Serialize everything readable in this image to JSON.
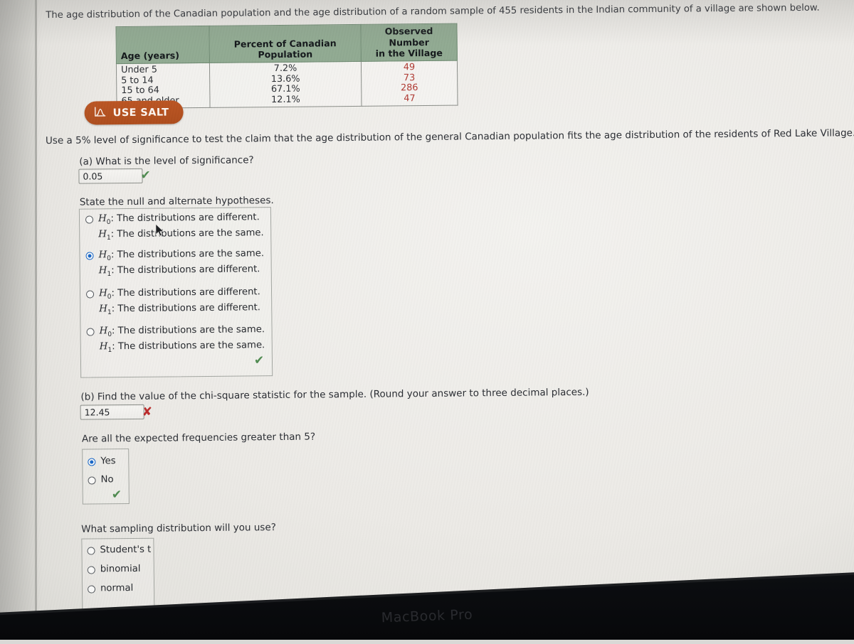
{
  "intro": {
    "paragraph": "The age distribution of the Canadian population and the age distribution of a random sample of 455 residents in the Indian community of a village are shown below."
  },
  "table": {
    "headers": {
      "age": "Age (years)",
      "percent": "Percent of Canadian Population",
      "observed_line1": "Observed Number",
      "observed_line2": "in the Village"
    },
    "rows": [
      {
        "age": "Under 5",
        "percent": "7.2%",
        "observed": "49"
      },
      {
        "age": "5 to 14",
        "percent": "13.6%",
        "observed": "73"
      },
      {
        "age": "15 to 64",
        "percent": "67.1%",
        "observed": "286"
      },
      {
        "age": "65 and older",
        "percent": "12.1%",
        "observed": "47"
      }
    ]
  },
  "salt_button": {
    "label": "USE SALT",
    "icon": "distribution-curve-icon"
  },
  "instruction": "Use a 5% level of significance to test the claim that the age distribution of the general Canadian population fits the age distribution of the residents of Red Lake Village.",
  "part_a": {
    "prompt": "(a) What is the level of significance?",
    "answer_value": "0.05",
    "feedback": "✔",
    "feedback_state": "correct"
  },
  "hypotheses": {
    "prompt": "State the null and alternate hypotheses.",
    "options": [
      {
        "selected": false,
        "null_hyp": "H",
        "null_sub": "0",
        "null_text": ": The distributions are different.",
        "alt_hyp": "H",
        "alt_sub": "1",
        "alt_text": ": The distributions are the same."
      },
      {
        "selected": true,
        "null_hyp": "H",
        "null_sub": "0",
        "null_text": ": The distributions are the same.",
        "alt_hyp": "H",
        "alt_sub": "1",
        "alt_text": ": The distributions are different."
      },
      {
        "selected": false,
        "null_hyp": "H",
        "null_sub": "0",
        "null_text": ": The distributions are different.",
        "alt_hyp": "H",
        "alt_sub": "1",
        "alt_text": ": The distributions are different."
      },
      {
        "selected": false,
        "null_hyp": "H",
        "null_sub": "0",
        "null_text": ": The distributions are the same.",
        "alt_hyp": "H",
        "alt_sub": "1",
        "alt_text": ": The distributions are the same."
      }
    ],
    "feedback": "✔",
    "feedback_state": "correct"
  },
  "part_b": {
    "prompt": "(b) Find the value of the chi-square statistic for the sample. (Round your answer to three decimal places.)",
    "answer_value": "12.45",
    "feedback": "✘",
    "feedback_state": "incorrect"
  },
  "expected_freq": {
    "prompt": "Are all the expected frequencies greater than 5?",
    "options": [
      {
        "label": "Yes",
        "selected": true
      },
      {
        "label": "No",
        "selected": false
      }
    ],
    "feedback": "✔",
    "feedback_state": "correct"
  },
  "sampling_distribution": {
    "prompt": "What sampling distribution will you use?",
    "options": [
      {
        "label": "Student's t",
        "selected": false,
        "italic_tail": true
      },
      {
        "label": "binomial",
        "selected": false,
        "italic_tail": false
      },
      {
        "label": "normal",
        "selected": false,
        "italic_tail": false
      }
    ]
  },
  "device": {
    "brand_label": "MacBook Pro"
  },
  "colors": {
    "table_header_green": "#91aa92",
    "observed_number_red": "#b03a33",
    "salt_button_orange": "#ae4d1d",
    "correct_green": "#4f8b50",
    "incorrect_red": "#bb2b2b",
    "radio_selected_blue": "#1565c8"
  }
}
